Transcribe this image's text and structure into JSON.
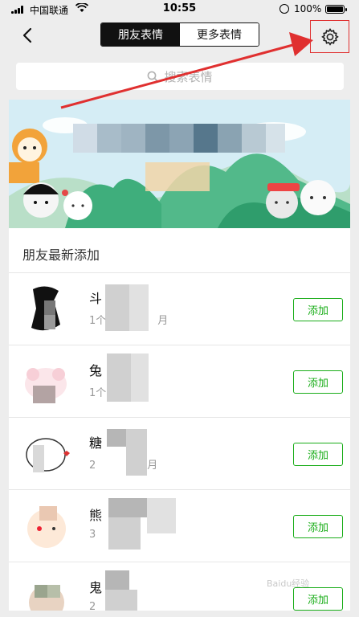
{
  "status_bar": {
    "carrier": "中国联通",
    "time": "10:55",
    "battery_percent": "100%"
  },
  "nav": {
    "tabs": [
      "朋友表情",
      "更多表情"
    ],
    "active_tab": 0,
    "settings_icon": "gear-icon",
    "back_icon": "chevron-left-icon"
  },
  "search": {
    "placeholder": "搜索表情"
  },
  "friends_section": {
    "title": "朋友最新添加",
    "items": [
      {
        "name": "斗",
        "subtitle": "1个",
        "subtitle_tail": "月",
        "button": "添加"
      },
      {
        "name": "兔",
        "subtitle": "1个",
        "subtitle_tail": "",
        "button": "添加"
      },
      {
        "name": "糖",
        "subtitle": "2",
        "subtitle_tail": "月",
        "button": "添加"
      },
      {
        "name": "熊",
        "subtitle": "3",
        "subtitle_tail": "",
        "button": "添加"
      },
      {
        "name": "鬼",
        "subtitle": "2",
        "subtitle_tail": "",
        "button": "添加"
      }
    ]
  },
  "colors": {
    "accent_green": "#1aad19",
    "annotation_red": "#e03030",
    "background": "#ededed"
  },
  "watermark": "Baidu经验"
}
